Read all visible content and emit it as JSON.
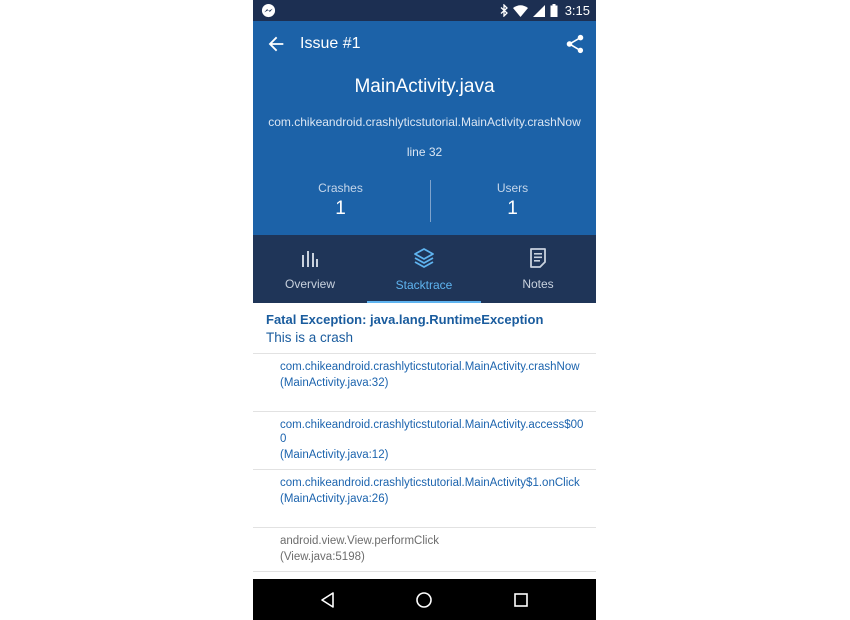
{
  "status_bar": {
    "time": "3:15",
    "icons": [
      "messenger-icon",
      "bluetooth-icon",
      "wifi-icon",
      "signal-icon",
      "battery-icon"
    ]
  },
  "toolbar": {
    "title": "Issue #1",
    "back_icon": "arrow-back-icon",
    "share_icon": "share-icon"
  },
  "issue": {
    "file": "MainActivity.java",
    "method": "com.chikeandroid.crashlyticstutorial.MainActivity.crashNow",
    "line": "line 32",
    "stats": [
      {
        "label": "Crashes",
        "value": "1"
      },
      {
        "label": "Users",
        "value": "1"
      }
    ]
  },
  "tabs": [
    {
      "label": "Overview",
      "icon": "bar-chart-icon",
      "active": false
    },
    {
      "label": "Stacktrace",
      "icon": "layers-icon",
      "active": true
    },
    {
      "label": "Notes",
      "icon": "document-icon",
      "active": false
    }
  ],
  "stacktrace": {
    "exception_title": "Fatal Exception: java.lang.RuntimeException",
    "exception_message": "This is a crash",
    "frames": [
      {
        "method": "com.chikeandroid.crashlyticstutorial.MainActivity.crashNow",
        "location": "(MainActivity.java:32)",
        "app_frame": true
      },
      {
        "method": "com.chikeandroid.crashlyticstutorial.MainActivity.access$000",
        "location": "(MainActivity.java:12)",
        "app_frame": true
      },
      {
        "method": "com.chikeandroid.crashlyticstutorial.MainActivity$1.onClick",
        "location": "(MainActivity.java:26)",
        "app_frame": true
      },
      {
        "method": "android.view.View.performClick",
        "location": "(View.java:5198)",
        "app_frame": false
      }
    ]
  },
  "nav_bar": {
    "buttons": [
      "back-icon",
      "home-icon",
      "recents-icon"
    ]
  },
  "colors": {
    "status_bar": "#1c2f52",
    "header": "#1c62a8",
    "tab_bar": "#1f3558",
    "tab_active": "#5fb4f0",
    "link_text": "#1c64ae",
    "dim_text": "#6d6d6d"
  }
}
